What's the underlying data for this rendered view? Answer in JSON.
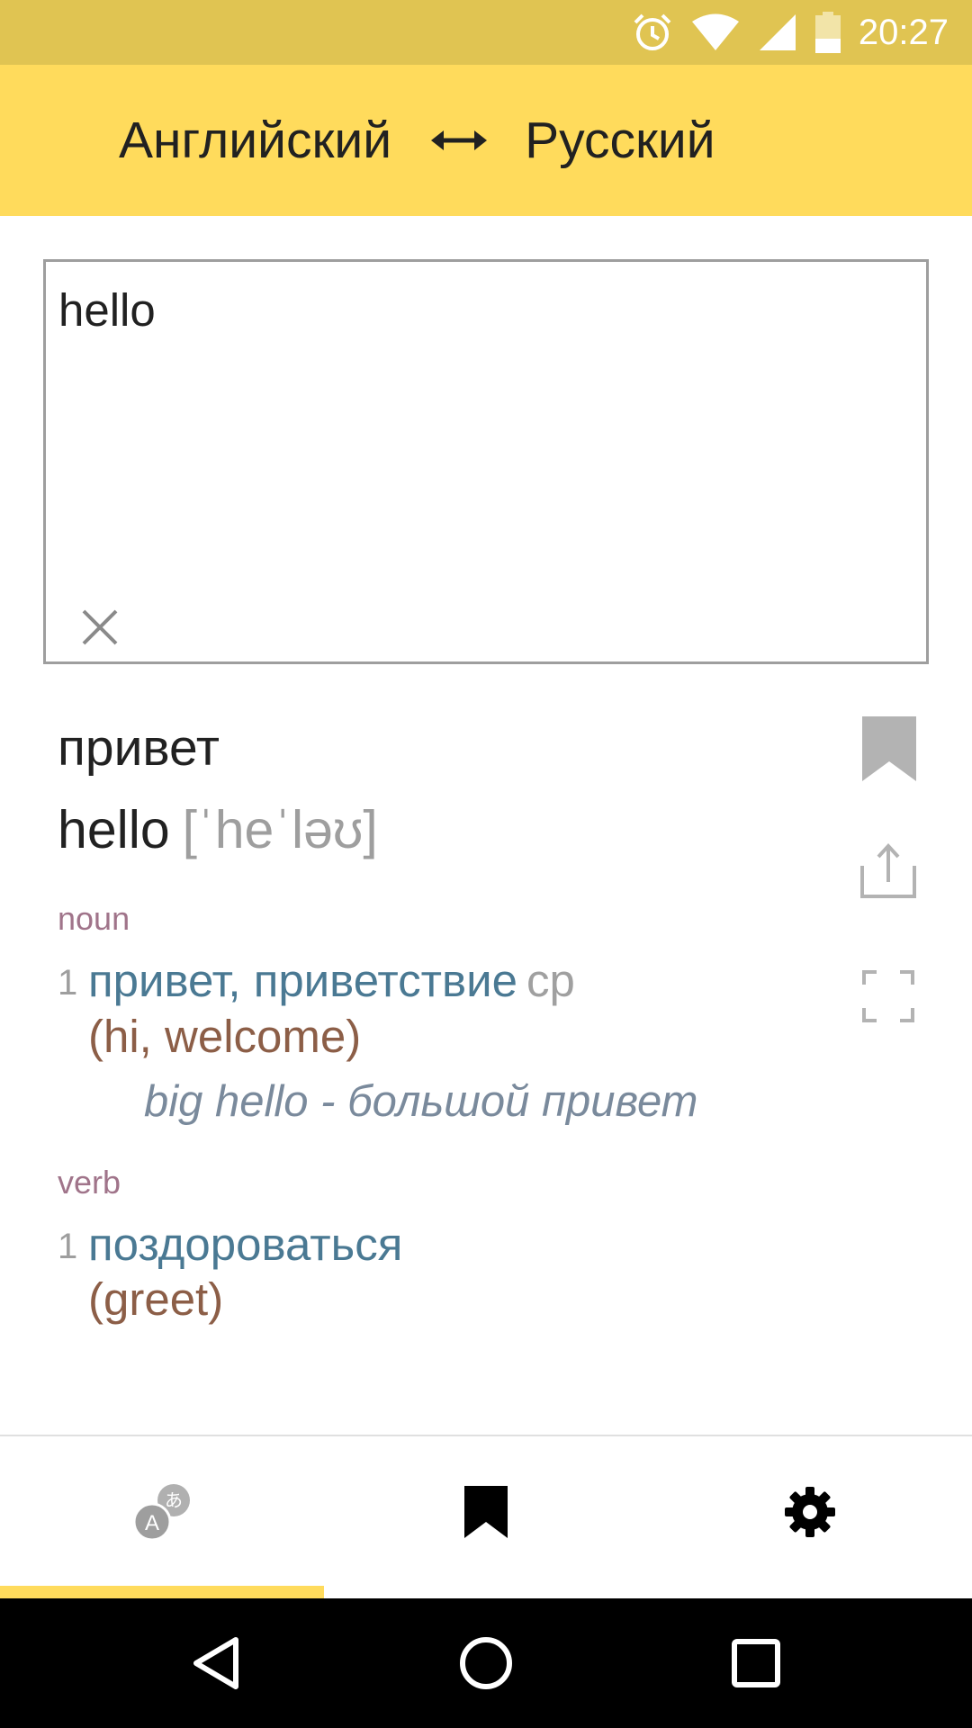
{
  "status_bar": {
    "time": "20:27",
    "icons": [
      "alarm-icon",
      "wifi-icon",
      "cellular-icon",
      "battery-icon"
    ],
    "color": "#e0c452"
  },
  "toolbar": {
    "source_language": "Английский",
    "target_language": "Русский",
    "swap_icon": "swap-arrows-icon",
    "color": "#ffdb5c"
  },
  "input": {
    "value": "hello",
    "clear_icon": "close-icon"
  },
  "result": {
    "translation": "привет",
    "headword": "hello",
    "transcription": "[ˈheˈləʊ]",
    "sections": [
      {
        "pos": "noun",
        "definitions": [
          {
            "number": "1",
            "words": "привет, приветствие",
            "gender": "ср",
            "meaning": "(hi, welcome)",
            "example": "big hello - большой привет"
          }
        ]
      },
      {
        "pos": "verb",
        "definitions": [
          {
            "number": "1",
            "words": "поздороваться",
            "meaning": "(greet)"
          }
        ]
      }
    ],
    "actions": [
      "bookmark-icon",
      "share-icon",
      "fullscreen-icon"
    ]
  },
  "bottom_nav": {
    "items": [
      "translate-icon",
      "bookmarks-icon",
      "settings-icon"
    ],
    "active_index": 0
  },
  "system_nav": [
    "back-icon",
    "home-icon",
    "recents-icon"
  ]
}
